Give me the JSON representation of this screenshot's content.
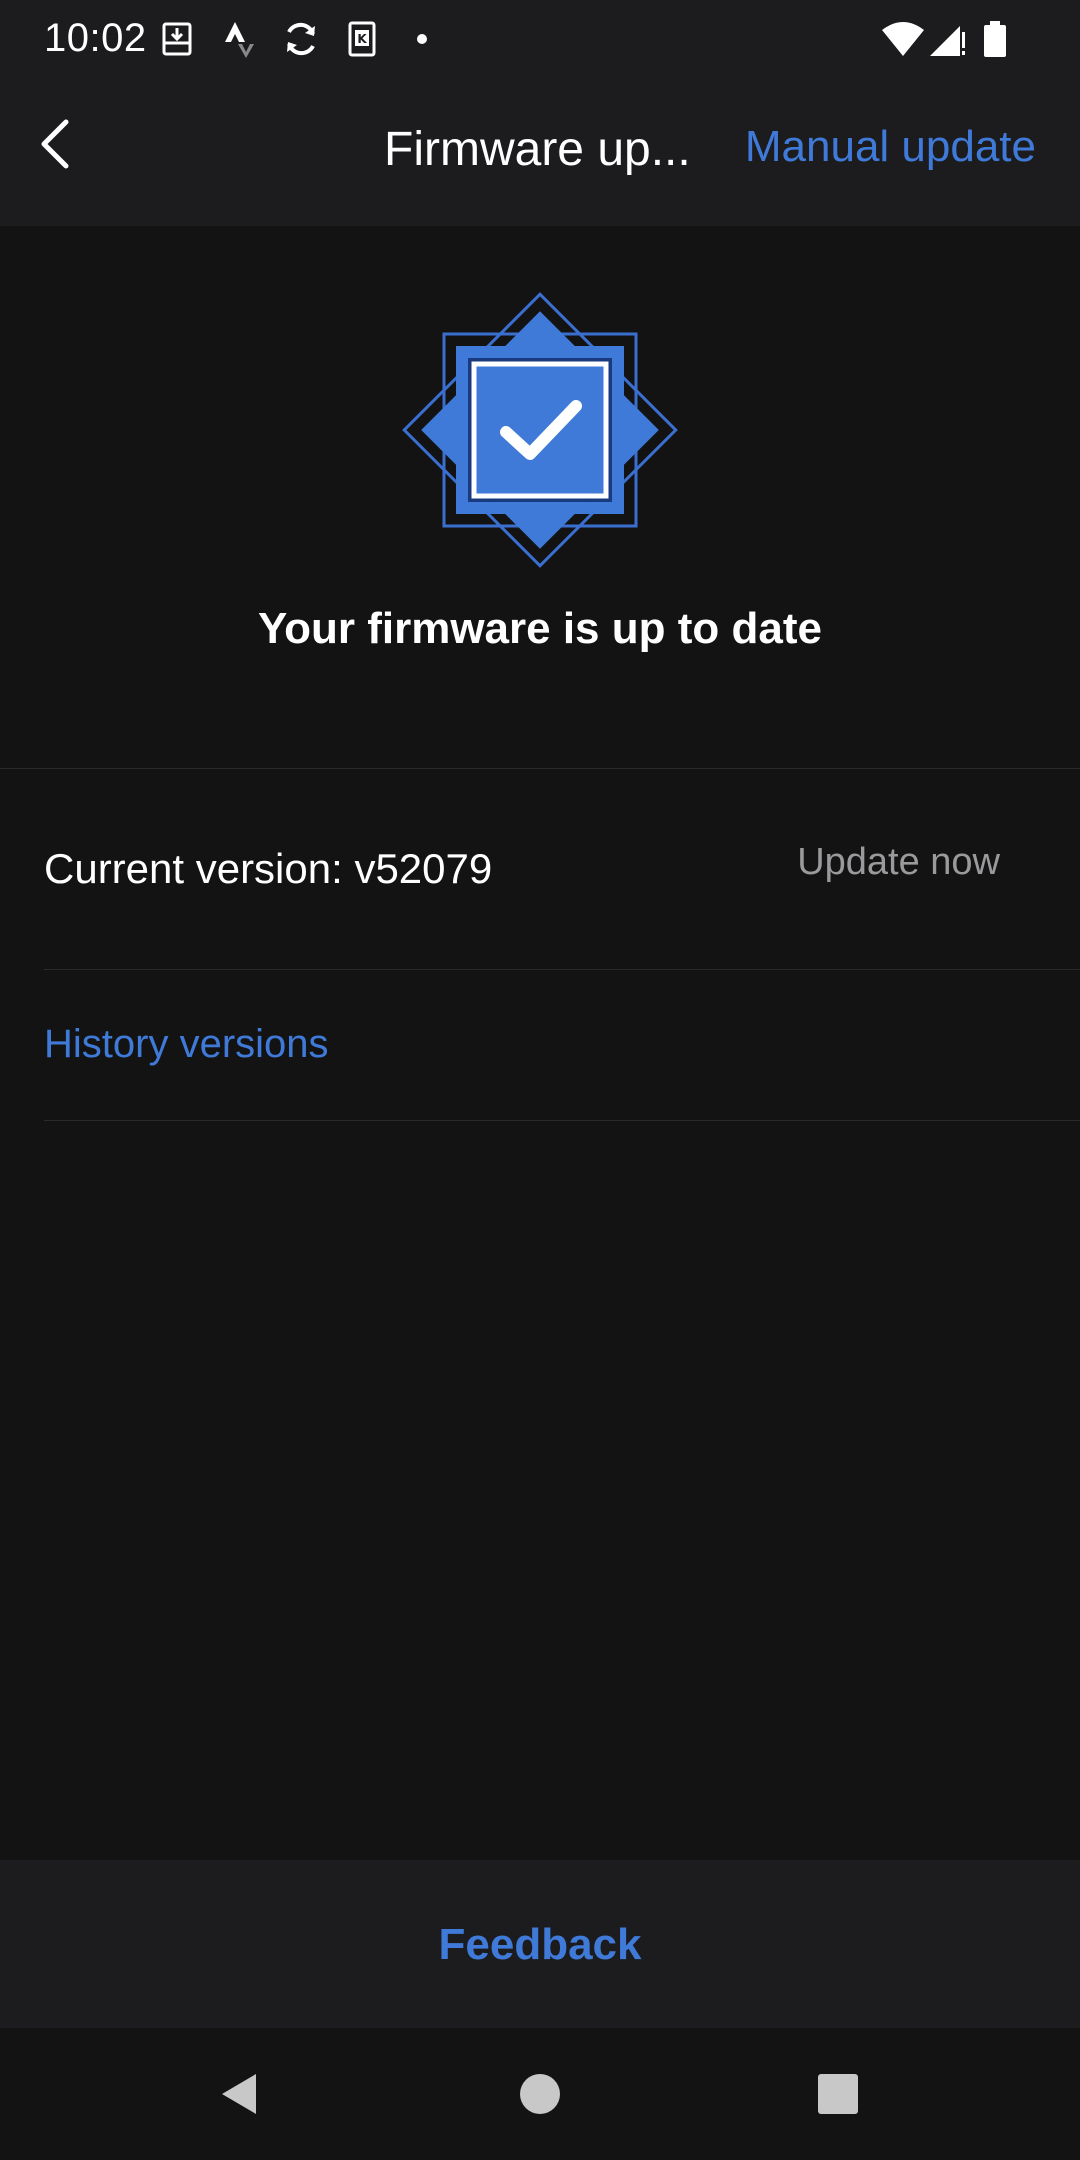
{
  "status_bar": {
    "time": "10:02",
    "icons": [
      "download-box-icon",
      "strava-icon",
      "sync-icon",
      "k-app-icon",
      "dot-icon",
      "wifi-icon",
      "signal-icon",
      "battery-icon"
    ]
  },
  "app_bar": {
    "title": "Firmware up...",
    "action_label": "Manual update"
  },
  "hero": {
    "headline": "Your firmware is up to date",
    "badge_icon": "verified-check-badge-icon"
  },
  "version": {
    "current_label": "Current version: v52079",
    "update_label": "Update now"
  },
  "history": {
    "label": "History versions"
  },
  "footer": {
    "feedback_label": "Feedback"
  },
  "nav_bar": {
    "icons": [
      "back-triangle-icon",
      "home-circle-icon",
      "recents-square-icon"
    ]
  },
  "colors": {
    "accent": "#3f7ad8",
    "background": "#131314",
    "surface": "#1c1c1e",
    "muted_text": "#9a9a9c"
  }
}
